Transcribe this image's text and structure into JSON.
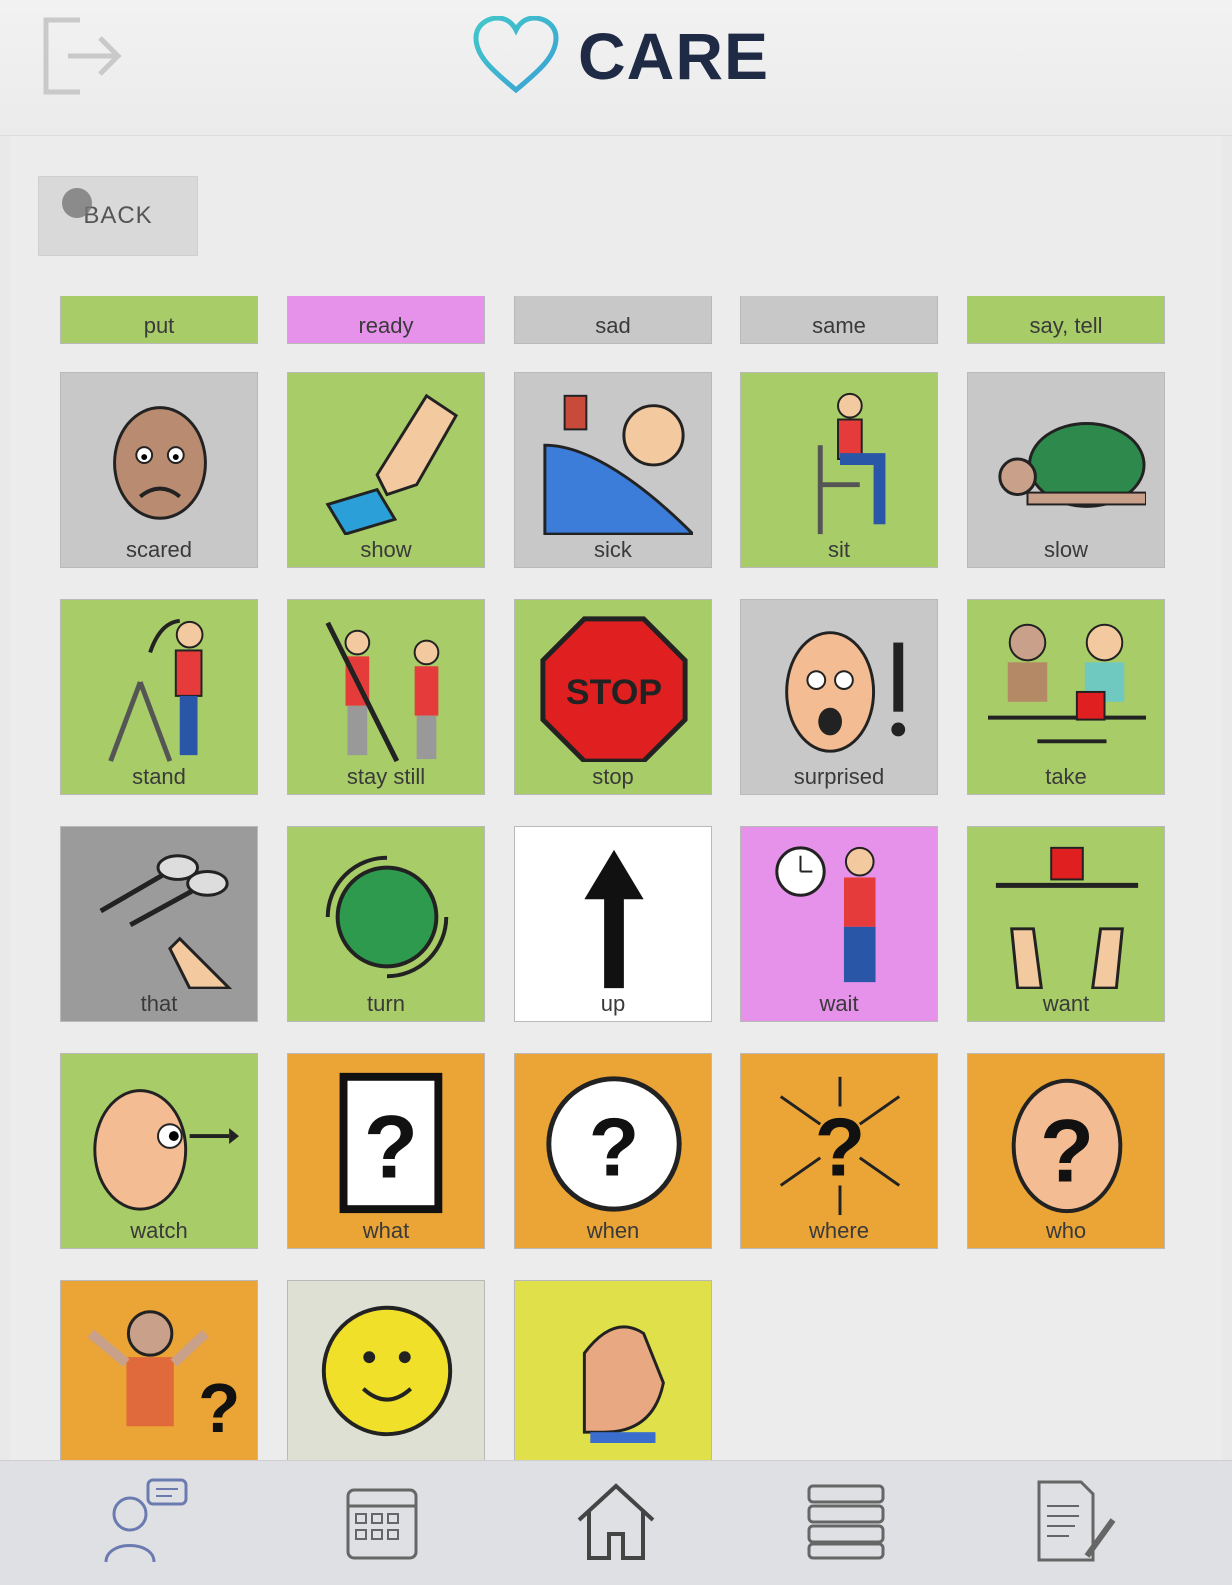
{
  "app": {
    "title": "CARE"
  },
  "back_button": {
    "label": "BACK"
  },
  "colors": {
    "green": "#a8cc68",
    "pink": "#e692ea",
    "gray": "#c8c8c9",
    "darkgray": "#9b9b9b",
    "white": "#ffffff",
    "orange": "#eaa536",
    "pale": "#dde0d2",
    "yellow": "#dfe04a",
    "brand_heart": "#3fc0c8",
    "brand_text": "#1f2a44"
  },
  "tiles_partial": [
    {
      "label": "put",
      "color": "green"
    },
    {
      "label": "ready",
      "color": "pink"
    },
    {
      "label": "sad",
      "color": "gray"
    },
    {
      "label": "same",
      "color": "gray"
    },
    {
      "label": "say, tell",
      "color": "green"
    }
  ],
  "tiles": [
    {
      "label": "scared",
      "color": "gray",
      "icon": "scared-face-icon"
    },
    {
      "label": "show",
      "color": "green",
      "icon": "pointing-finger-card-icon"
    },
    {
      "label": "sick",
      "color": "gray",
      "icon": "sick-in-bed-icon"
    },
    {
      "label": "sit",
      "color": "green",
      "icon": "person-sitting-icon"
    },
    {
      "label": "slow",
      "color": "gray",
      "icon": "turtle-icon"
    },
    {
      "label": "stand",
      "color": "green",
      "icon": "person-standing-up-icon"
    },
    {
      "label": "stay still",
      "color": "green",
      "icon": "stay-still-icon"
    },
    {
      "label": "stop",
      "color": "green",
      "icon": "stop-sign-icon"
    },
    {
      "label": "surprised",
      "color": "gray",
      "icon": "surprised-face-icon"
    },
    {
      "label": "take",
      "color": "green",
      "icon": "take-object-icon"
    },
    {
      "label": "that",
      "color": "darkgray",
      "icon": "pointing-spoons-icon"
    },
    {
      "label": "turn",
      "color": "green",
      "icon": "turn-circle-icon"
    },
    {
      "label": "up",
      "color": "white",
      "icon": "up-arrow-icon"
    },
    {
      "label": "wait",
      "color": "pink",
      "icon": "wait-clock-person-icon"
    },
    {
      "label": "want",
      "color": "green",
      "icon": "want-hands-icon"
    },
    {
      "label": "watch",
      "color": "green",
      "icon": "watch-eye-icon"
    },
    {
      "label": "what",
      "color": "orange",
      "icon": "question-box-icon"
    },
    {
      "label": "when",
      "color": "orange",
      "icon": "question-clock-icon"
    },
    {
      "label": "where",
      "color": "orange",
      "icon": "question-arrows-icon"
    },
    {
      "label": "who",
      "color": "orange",
      "icon": "question-head-icon"
    },
    {
      "label": "",
      "color": "orange",
      "icon": "shrug-question-icon"
    },
    {
      "label": "",
      "color": "pale",
      "icon": "smiley-flower-icon"
    },
    {
      "label": "",
      "color": "yellow",
      "icon": "pointing-at-you-icon"
    }
  ],
  "tabbar": [
    "chat-person-icon",
    "calendar-icon",
    "home-icon",
    "books-icon",
    "notes-edit-icon"
  ]
}
